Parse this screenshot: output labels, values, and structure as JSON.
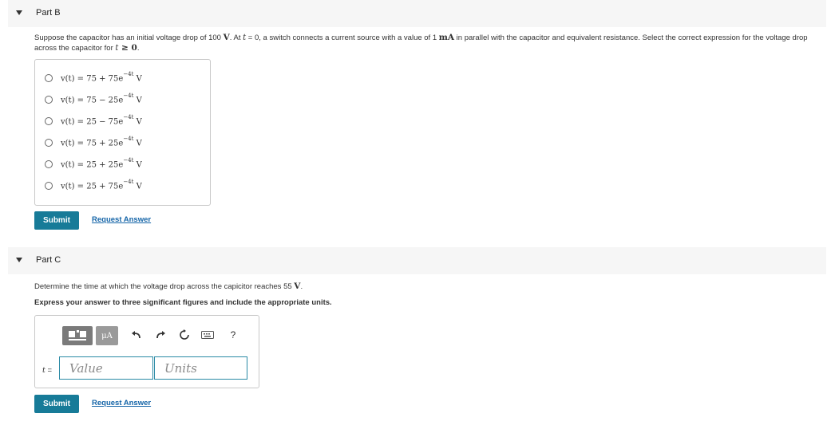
{
  "partB": {
    "title": "Part B",
    "prompt": {
      "t1": "Suppose the capacitor has an initial voltage drop of 100 ",
      "unit_v": "V",
      "t2": ". At ",
      "var_t": "t",
      "t3": " = 0, a switch connects a current source with a value of 1 ",
      "unit_ma": "mA",
      "t4": " in parallel with the capacitor and equivalent resistance. Select the correct expression for the voltage drop across the capacitor for ",
      "var_t2": "t",
      "cond": " ≥ 0",
      "t5": "."
    },
    "choices": [
      {
        "base": "v(t) = 75 + 75e",
        "exp": "−4t",
        "unit": " V"
      },
      {
        "base": "v(t) = 75 − 25e",
        "exp": "−4t",
        "unit": " V"
      },
      {
        "base": "v(t) = 25 − 75e",
        "exp": "−4t",
        "unit": " V"
      },
      {
        "base": "v(t) = 75 + 25e",
        "exp": "−4t",
        "unit": " V"
      },
      {
        "base": "v(t) = 25 + 25e",
        "exp": "−4t",
        "unit": " V"
      },
      {
        "base": "v(t) = 25 + 75e",
        "exp": "−4t",
        "unit": " V"
      }
    ],
    "submit_label": "Submit",
    "request_label": "Request Answer"
  },
  "partC": {
    "title": "Part C",
    "prompt_text": "Determine the time at which the voltage drop across the capicitor reaches 55 ",
    "prompt_unit": "V",
    "prompt_end": ".",
    "instruction": "Express your answer to three significant figures and include the appropriate units.",
    "toolbar": {
      "templates_icon": "templates-icon",
      "units_label": "μA",
      "help_label": "?",
      "icons": [
        "undo-icon",
        "redo-icon",
        "reset-icon",
        "keyboard-icon",
        "help-icon"
      ]
    },
    "var_label": "t",
    "equals": " =",
    "value_placeholder": "Value",
    "units_placeholder": "Units",
    "submit_label": "Submit",
    "request_label": "Request Answer"
  },
  "colors": {
    "accent": "#177b98",
    "link": "#1565a8",
    "header_bg": "#f6f6f6",
    "field_border": "#2a8aa5"
  }
}
